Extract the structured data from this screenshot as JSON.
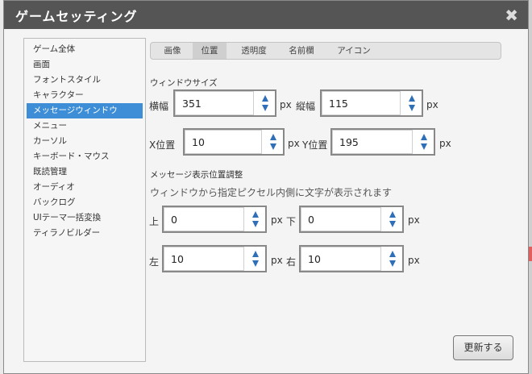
{
  "dialog": {
    "title": "ゲームセッティング",
    "close_symbol": "✖"
  },
  "sidebar": {
    "items": [
      {
        "label": "ゲーム全体"
      },
      {
        "label": "画面"
      },
      {
        "label": "フォントスタイル"
      },
      {
        "label": "キャラクター"
      },
      {
        "label": "メッセージウィンドウ",
        "active": true
      },
      {
        "label": "メニュー"
      },
      {
        "label": "カーソル"
      },
      {
        "label": "キーボード・マウス"
      },
      {
        "label": "既読管理"
      },
      {
        "label": "オーディオ"
      },
      {
        "label": "バックログ"
      },
      {
        "label": "UIテーマ一括変換"
      },
      {
        "label": "ティラノビルダー"
      }
    ]
  },
  "tabs": [
    {
      "label": "画像"
    },
    {
      "label": "位置",
      "active": true
    },
    {
      "label": "透明度"
    },
    {
      "label": "名前欄"
    },
    {
      "label": "アイコン"
    }
  ],
  "window_size": {
    "heading": "ウィンドウサイズ",
    "width_label": "横幅",
    "width_value": "351",
    "height_label": "縦幅",
    "height_value": "115",
    "unit": "px"
  },
  "window_position": {
    "x_label": "X位置",
    "x_value": "10",
    "y_label": "Y位置",
    "y_value": "195",
    "unit": "px"
  },
  "padding": {
    "heading": "メッセージ表示位置調整",
    "description": "ウィンドウから指定ピクセル内側に文字が表示されます",
    "top_label": "上",
    "top_value": "0",
    "bottom_label": "下",
    "bottom_value": "0",
    "left_label": "左",
    "left_value": "10",
    "right_label": "右",
    "right_value": "10",
    "unit": "px"
  },
  "update_button": "更新する"
}
